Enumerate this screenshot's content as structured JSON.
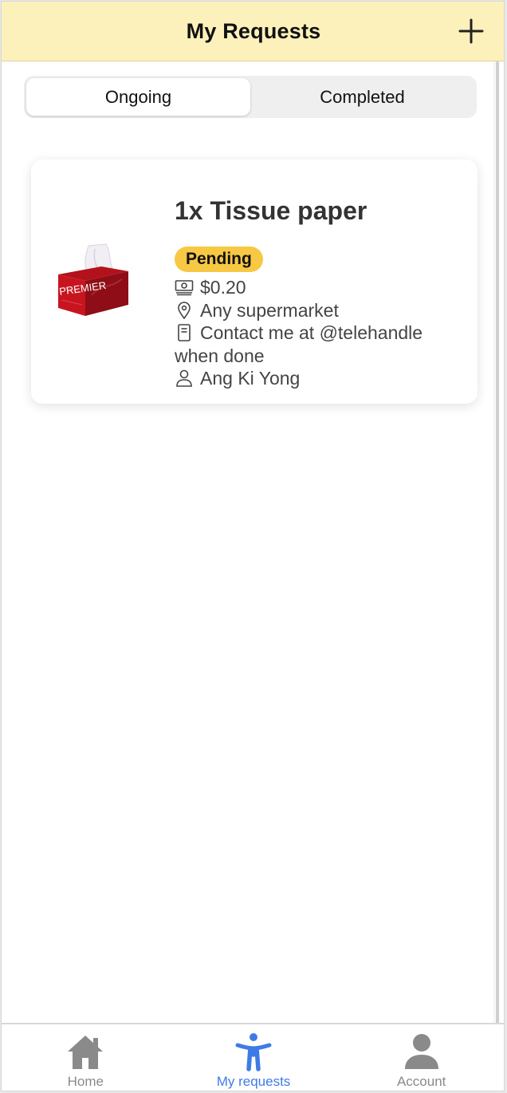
{
  "header": {
    "title": "My Requests",
    "add_icon": "plus-icon"
  },
  "tabs": [
    {
      "label": "Ongoing",
      "active": true
    },
    {
      "label": "Completed",
      "active": false
    }
  ],
  "request": {
    "title": "1x Tissue paper",
    "status": "Pending",
    "status_color": "#f7c843",
    "price": "$0.20",
    "location": "Any supermarket",
    "note": "Contact me at @telehandle when done",
    "requester": "Ang Ki Yong",
    "image_text": "PREMIER",
    "icons": [
      "money-icon",
      "location-pin-icon",
      "note-icon",
      "person-icon"
    ]
  },
  "tabbar": [
    {
      "label": "Home",
      "icon": "home-icon",
      "active": false
    },
    {
      "label": "My requests",
      "icon": "accessibility-person-icon",
      "active": true
    },
    {
      "label": "Account",
      "icon": "account-icon",
      "active": false
    }
  ],
  "colors": {
    "header_bg": "#fdf1bb",
    "accent": "#3f7be6",
    "inactive": "#8a8a8a"
  }
}
